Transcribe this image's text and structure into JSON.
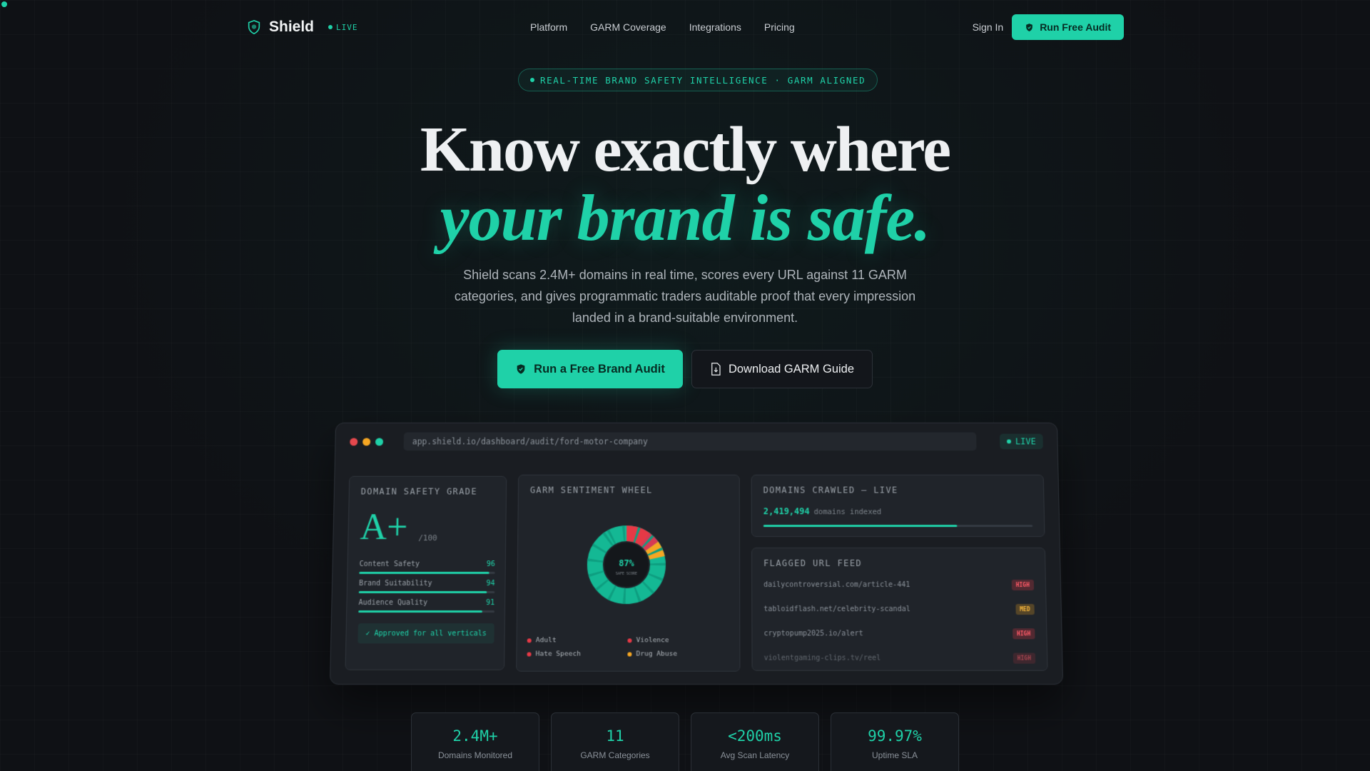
{
  "nav": {
    "brand": "Shield",
    "live": "LIVE",
    "links": [
      "Platform",
      "GARM Coverage",
      "Integrations",
      "Pricing"
    ],
    "sign_in": "Sign In",
    "cta": "Run Free Audit"
  },
  "hero": {
    "badge": "REAL-TIME BRAND SAFETY INTELLIGENCE · GARM ALIGNED",
    "title_line1": "Know exactly where",
    "title_line2": "your brand is safe.",
    "subtitle": "Shield scans 2.4M+ domains in real time, scores every URL against 11 GARM categories, and gives programmatic traders auditable proof that every impression landed in a brand-suitable environment.",
    "primary_cta": "Run a Free Brand Audit",
    "secondary_cta": "Download GARM Guide"
  },
  "dashboard": {
    "url": "app.shield.io/dashboard/audit/ford-motor-company",
    "live": "LIVE",
    "safety": {
      "title": "DOMAIN SAFETY GRADE",
      "grade": "A+",
      "denominator": "/100",
      "metrics": [
        {
          "label": "Content Safety",
          "value": "96",
          "pct": 96
        },
        {
          "label": "Brand Suitability",
          "value": "94",
          "pct": 94
        },
        {
          "label": "Audience Quality",
          "value": "91",
          "pct": 91
        }
      ],
      "approved": "✓ Approved for all verticals"
    },
    "wheel": {
      "title": "GARM SENTIMENT WHEEL",
      "score": "87%",
      "score_label": "SAFE SCORE",
      "legend": [
        {
          "label": "Adult",
          "color": "#e63946"
        },
        {
          "label": "Violence",
          "color": "#e63946"
        },
        {
          "label": "Hate Speech",
          "color": "#e63946"
        },
        {
          "label": "Drug Abuse",
          "color": "#f5a623"
        }
      ]
    },
    "crawled": {
      "title": "DOMAINS CRAWLED — LIVE",
      "count": "2,419,494",
      "unit": "domains indexed",
      "progress": 0.72
    },
    "feed": {
      "title": "FLAGGED URL FEED",
      "items": [
        {
          "url": "dailycontroversial.com/article-441",
          "level": "HIGH"
        },
        {
          "url": "tabloidflash.net/celebrity-scandal",
          "level": "MED"
        },
        {
          "url": "cryptopump2025.io/alert",
          "level": "HIGH"
        },
        {
          "url": "violentgaming-clips.tv/reel",
          "level": "HIGH"
        }
      ]
    }
  },
  "stats": [
    {
      "value": "2.4M+",
      "label": "Domains Monitored"
    },
    {
      "value": "11",
      "label": "GARM Categories"
    },
    {
      "value": "<200ms",
      "label": "Avg Scan Latency"
    },
    {
      "value": "99.97%",
      "label": "Uptime SLA"
    }
  ],
  "colors": {
    "accent": "#1fd1a8",
    "background": "#0f1115",
    "danger": "#e63946",
    "warning": "#f5a623"
  }
}
